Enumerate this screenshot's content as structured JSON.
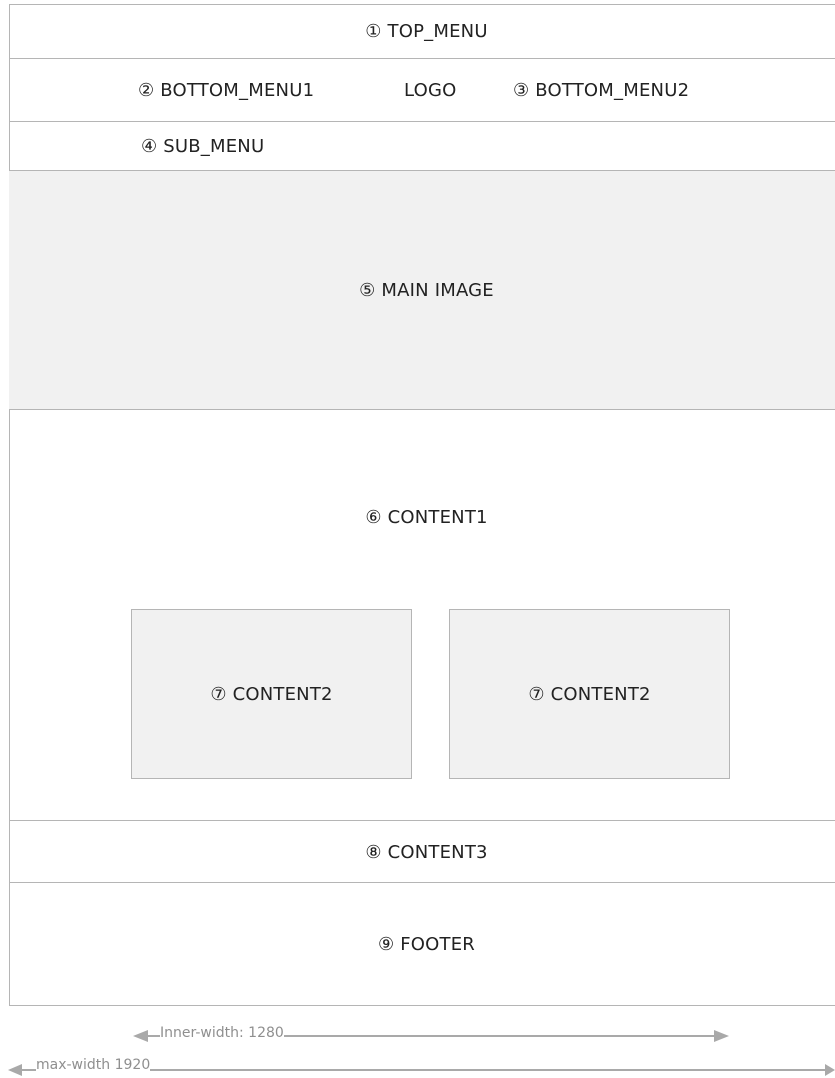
{
  "top_menu": {
    "label": "① TOP_MENU"
  },
  "nav": {
    "bottom_menu1": "② BOTTOM_MENU1",
    "logo": "LOGO",
    "bottom_menu2": "③ BOTTOM_MENU2"
  },
  "sub_menu": {
    "label": "④  SUB_MENU"
  },
  "main_image": {
    "label": "⑤  MAIN IMAGE"
  },
  "content1": {
    "label": "⑥  CONTENT1"
  },
  "content2": [
    {
      "label": "⑦  CONTENT2"
    },
    {
      "label": "⑦  CONTENT2"
    }
  ],
  "content3": {
    "label": "⑧ CONTENT3"
  },
  "footer": {
    "label": "⑨ FOOTER"
  },
  "dimensions": {
    "inner_width_label": "Inner-width: 1280",
    "max_width_label": "max-width 1920"
  },
  "colors": {
    "border": "#b5b5b5",
    "fill": "#f1f1f1",
    "arrow": "#a9a9a9",
    "dim_text": "#8f8f8f"
  }
}
